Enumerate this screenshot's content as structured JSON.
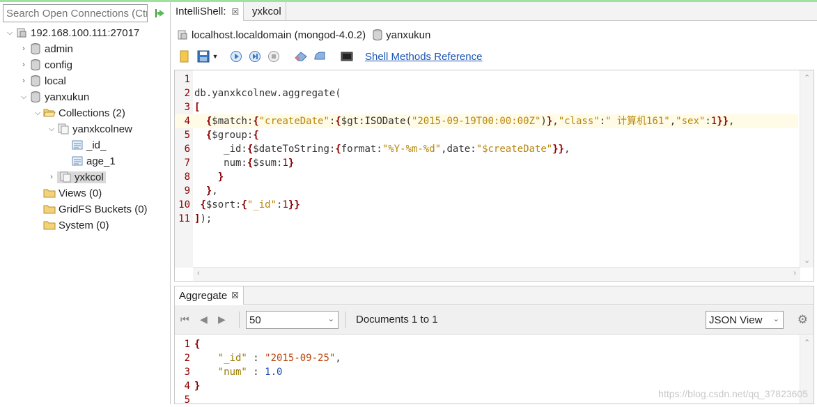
{
  "search": {
    "placeholder": "Search Open Connections (Ctrl+F)"
  },
  "tree": {
    "connection": "192.168.100.111:27017",
    "databases": [
      "admin",
      "config",
      "local"
    ],
    "current_db": "yanxukun",
    "collections_label": "Collections (2)",
    "collection_1": "yanxkcolnew",
    "indexes": [
      "_id_",
      "age_1"
    ],
    "collection_2": "yxkcol",
    "views_label": "Views (0)",
    "gridfs_label": "GridFS Buckets (0)",
    "system_label": "System (0)"
  },
  "tabs": [
    {
      "label": "IntelliShell:"
    },
    {
      "label": "yxkcol"
    }
  ],
  "connection_bar": {
    "host": "localhost.localdomain (mongod-4.0.2)",
    "database": "yanxukun"
  },
  "toolbar": {
    "shell_methods_link": "Shell Methods Reference"
  },
  "editor": {
    "line_numbers": [
      "1",
      "2",
      "3",
      "4",
      "5",
      "6",
      "7",
      "8",
      "9",
      "10",
      "11"
    ],
    "highlighted_line": 4
  },
  "results": {
    "tab_label": "Aggregate",
    "page_size": "50",
    "docs_label": "Documents 1 to 1",
    "view_mode": "JSON View",
    "line_numbers": [
      "1",
      "2",
      "3",
      "4",
      "5"
    ]
  },
  "watermark": "https://blog.csdn.net/qq_37823605"
}
